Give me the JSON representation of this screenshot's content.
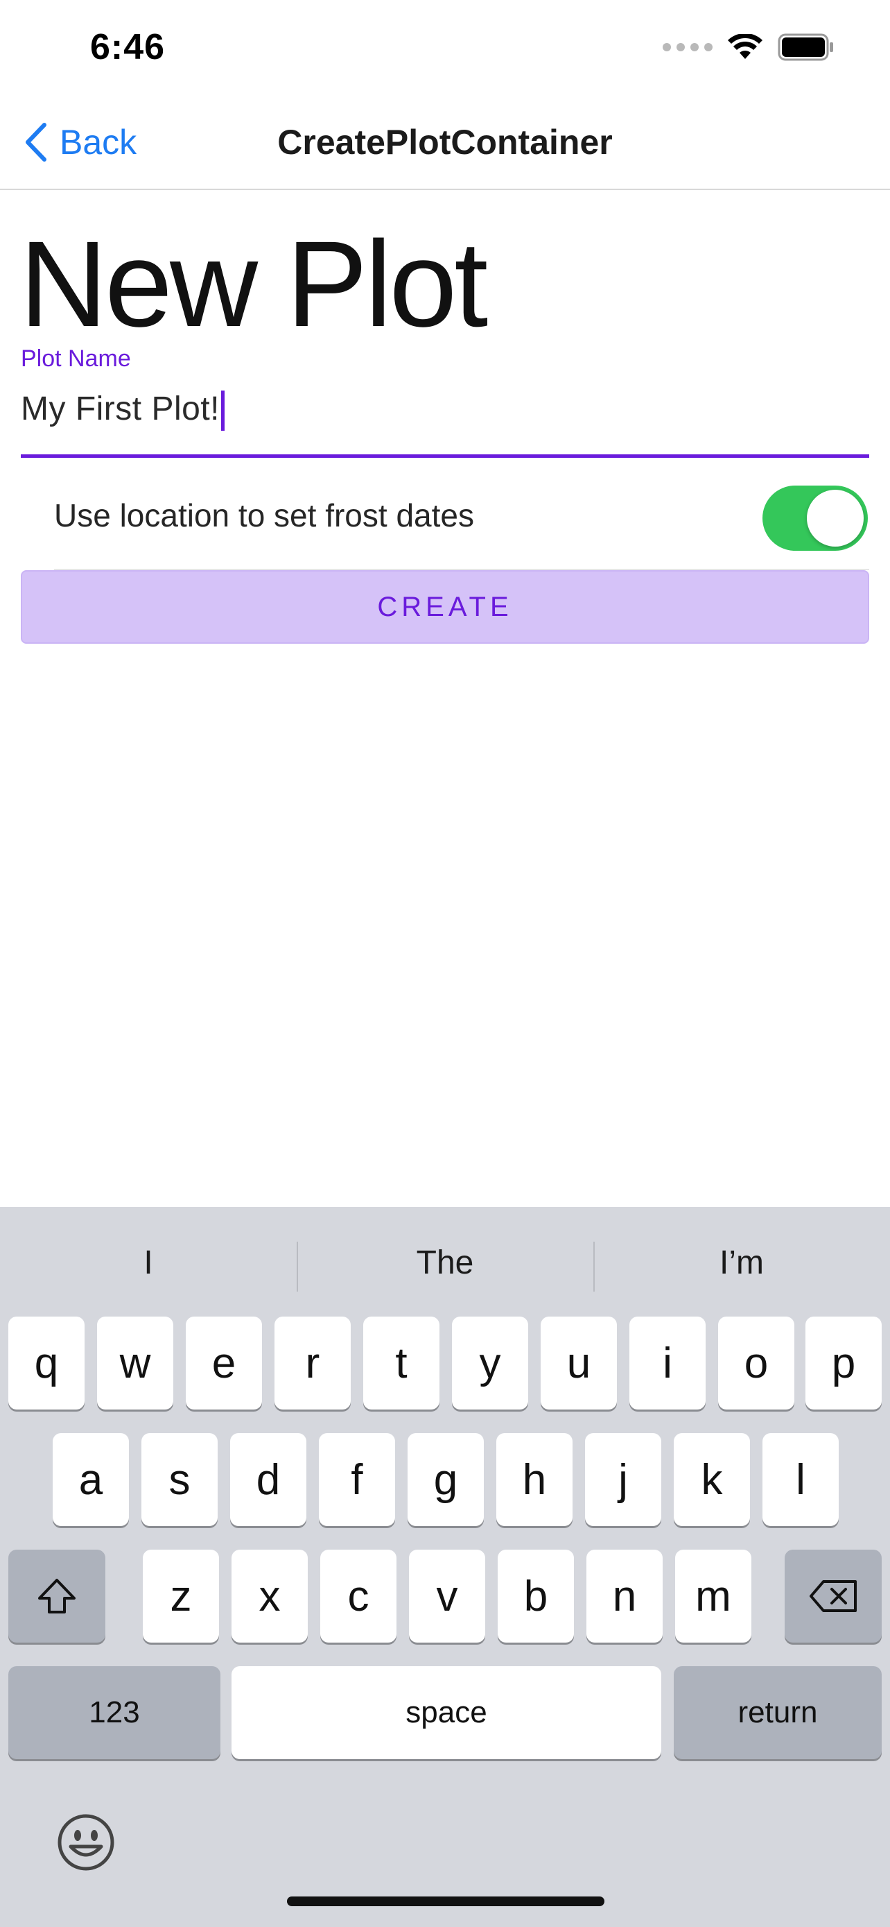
{
  "status_bar": {
    "time": "6:46",
    "icons": [
      "signal-dots-icon",
      "wifi-icon",
      "battery-icon"
    ]
  },
  "nav": {
    "back_label": "Back",
    "title": "CreatePlotContainer"
  },
  "page": {
    "title": "New Plot",
    "plot_name": {
      "label": "Plot Name",
      "value": "My First Plot!"
    },
    "location_toggle": {
      "label": "Use location to set frost dates",
      "enabled": true
    },
    "create_label": "CREATE"
  },
  "keyboard": {
    "suggestions": [
      "I",
      "The",
      "I’m"
    ],
    "row1": [
      "q",
      "w",
      "e",
      "r",
      "t",
      "y",
      "u",
      "i",
      "o",
      "p"
    ],
    "row2": [
      "a",
      "s",
      "d",
      "f",
      "g",
      "h",
      "j",
      "k",
      "l"
    ],
    "row3": [
      "z",
      "x",
      "c",
      "v",
      "b",
      "n",
      "m"
    ],
    "numbers_label": "123",
    "space_label": "space",
    "return_label": "return"
  },
  "colors": {
    "accent": "#6a1bdc",
    "link": "#1e7cf2",
    "toggle_on": "#34c75a",
    "create_bg": "#d5c2f8",
    "keyboard_bg": "#d5d7dd"
  }
}
